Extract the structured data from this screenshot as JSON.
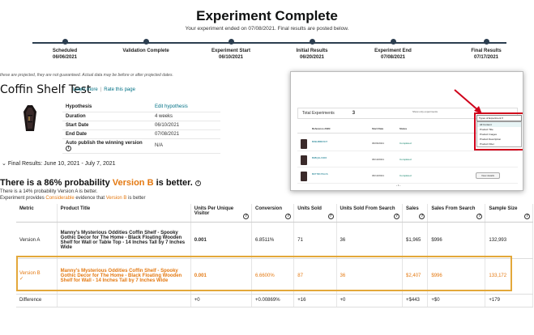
{
  "header": {
    "title": "Experiment Complete",
    "subtitle": "Your experiment ended on 07/08/2021. Final results are posted below."
  },
  "timeline": [
    {
      "label": "Scheduled",
      "date": "06/06/2021"
    },
    {
      "label": "Validation Complete",
      "date": ""
    },
    {
      "label": "Experiment Start",
      "date": "06/10/2021"
    },
    {
      "label": "Initial Results",
      "date": "06/20/2021"
    },
    {
      "label": "Experiment End",
      "date": "07/08/2021"
    },
    {
      "label": "Final Results",
      "date": "07/17/2021"
    }
  ],
  "note": "these are projected, they are not guaranteed. Actual data may be before or after projected dates.",
  "test": {
    "title": "Coffin Shelf Test",
    "learn_more": "Learn more",
    "rate_page": "Rate this page"
  },
  "info": {
    "hypothesis_label": "Hypothesis",
    "hypothesis_value": "Edit hypothesis",
    "duration_label": "Duration",
    "duration_value": "4 weeks",
    "start_label": "Start Date",
    "start_value": "06/10/2021",
    "end_label": "End Date",
    "end_value": "07/08/2021",
    "autopublish_label": "Auto publish the winning version",
    "autopublish_value": "N/A"
  },
  "final_results": "Final Results: June 10, 2021 - July 7, 2021",
  "probability": {
    "heading_prefix": "There is a 86% probability ",
    "heading_version": "Version B",
    "heading_suffix": " is better.",
    "sub1": "There is a 14% probability Version A is better.",
    "sub2_prefix": "Experiment provides ",
    "sub2_em": "Considerable",
    "sub2_mid": " evidence that ",
    "sub2_version": "Version B",
    "sub2_suffix": " is better"
  },
  "table": {
    "headers": [
      "Metric",
      "Product Title",
      "Units Per Unique Visitor",
      "Conversion",
      "Units Sold",
      "Units Sold From Search",
      "Sales",
      "Sales From Search",
      "Sample Size"
    ],
    "rows": [
      {
        "metric": "Version A",
        "title": "Manny's Mysterious Oddities Coffin Shelf - Spooky Gothic Decor for The Home - Black Floating Wooden Shelf for Wall or Table Top - 14 Inches Tall by 7 Inches Wide",
        "upuv": "0.001",
        "conversion": "6.8511%",
        "units": "71",
        "units_search": "36",
        "sales": "$1,965",
        "sales_search": "$996",
        "sample": "132,993"
      },
      {
        "metric": "Version B",
        "title": "Manny's Mysterious Oddities Coffin Shelf - Spooky Gothic Decor for The Home - Black Floating Wooden Shelf for Wall - 14 Inches Tall by 7 Inches Wide",
        "upuv": "0.001",
        "conversion": "6.6600%",
        "units": "87",
        "units_search": "36",
        "sales": "$2,407",
        "sales_search": "$996",
        "sample": "133,172"
      },
      {
        "metric": "Difference",
        "title": "",
        "upuv": "+0",
        "conversion": "+0.00869%",
        "units": "+16",
        "units_search": "+0",
        "sales": "+$443",
        "sales_search": "+$0",
        "sample": "+179"
      }
    ]
  },
  "overlay": {
    "total_label": "Total Experiments",
    "total_value": "3",
    "show_only": "Show only experiments",
    "col_ref": "Reference ASIN",
    "col_start": "Start Date",
    "col_status": "Status",
    "rows": [
      {
        "asin": "B09H5BRXD7",
        "date": "06/06/2021",
        "status": "Completed",
        "btn": "View details"
      },
      {
        "asin": "B08Q1LX3F6",
        "date": "06/10/2021",
        "status": "Completed",
        "btn": "View details"
      },
      {
        "asin": "B07TRN7GCS",
        "date": "06/10/2021",
        "status": "Completed",
        "btn": "View details"
      }
    ],
    "dropdown": "Types of Experiment",
    "menu": [
      "All Content",
      "Product Title",
      "Product Images",
      "Product Description",
      "Product Filter"
    ],
    "pager": "‹ 1 ›"
  },
  "colors": {
    "accent_orange": "#e47911",
    "highlight_border": "#e3a83a",
    "link": "#007185",
    "red_box": "#d0021b"
  }
}
